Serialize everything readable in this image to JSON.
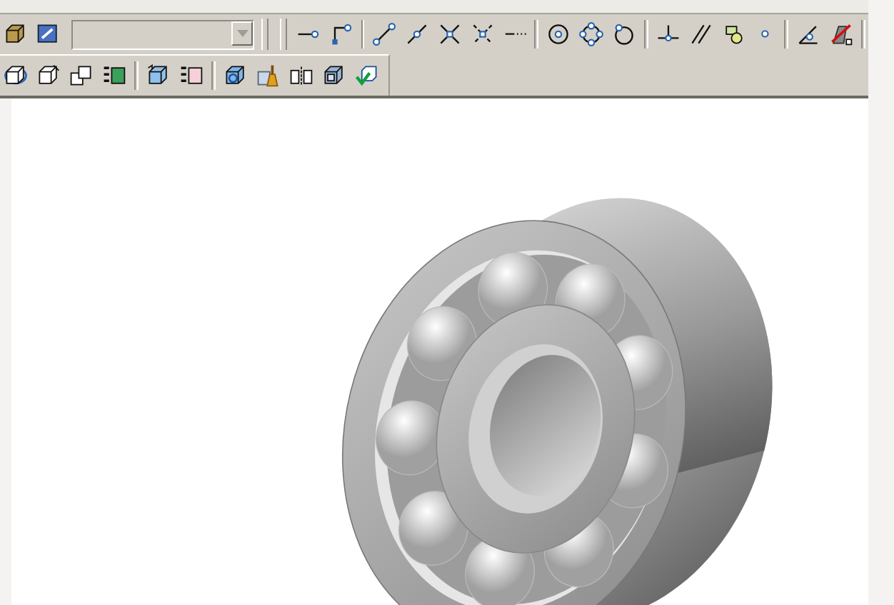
{
  "toolbar_top": {
    "left_items": [
      {
        "kind": "box"
      },
      {
        "kind": "box-arrow"
      }
    ],
    "layer_dropdown": {
      "disabled": true
    },
    "items": [
      {
        "kind": "endpoint"
      },
      {
        "kind": "corner"
      },
      {
        "kind": "separator"
      },
      {
        "kind": "line"
      },
      {
        "kind": "line-dot"
      },
      {
        "kind": "cross"
      },
      {
        "kind": "cross-dashed"
      },
      {
        "kind": "dashed-line"
      },
      {
        "kind": "separator"
      },
      {
        "kind": "circle-center"
      },
      {
        "kind": "circle-quad"
      },
      {
        "kind": "circle-tangent"
      },
      {
        "kind": "separator"
      },
      {
        "kind": "perpendicular"
      },
      {
        "kind": "parallel"
      },
      {
        "kind": "shapes"
      },
      {
        "kind": "dot"
      },
      {
        "kind": "separator"
      },
      {
        "kind": "angle"
      },
      {
        "kind": "cancel"
      },
      {
        "kind": "separator"
      }
    ]
  },
  "toolbar_bottom": {
    "items": [
      {
        "kind": "orbit"
      },
      {
        "kind": "rotate-box"
      },
      {
        "kind": "boxes"
      },
      {
        "kind": "grid-box"
      },
      {
        "kind": "separator"
      },
      {
        "kind": "box-blue"
      },
      {
        "kind": "grid-box-pink"
      },
      {
        "kind": "separator"
      },
      {
        "kind": "box-circle"
      },
      {
        "kind": "broom"
      },
      {
        "kind": "mirror"
      },
      {
        "kind": "box-frame"
      },
      {
        "kind": "box-check"
      }
    ]
  }
}
